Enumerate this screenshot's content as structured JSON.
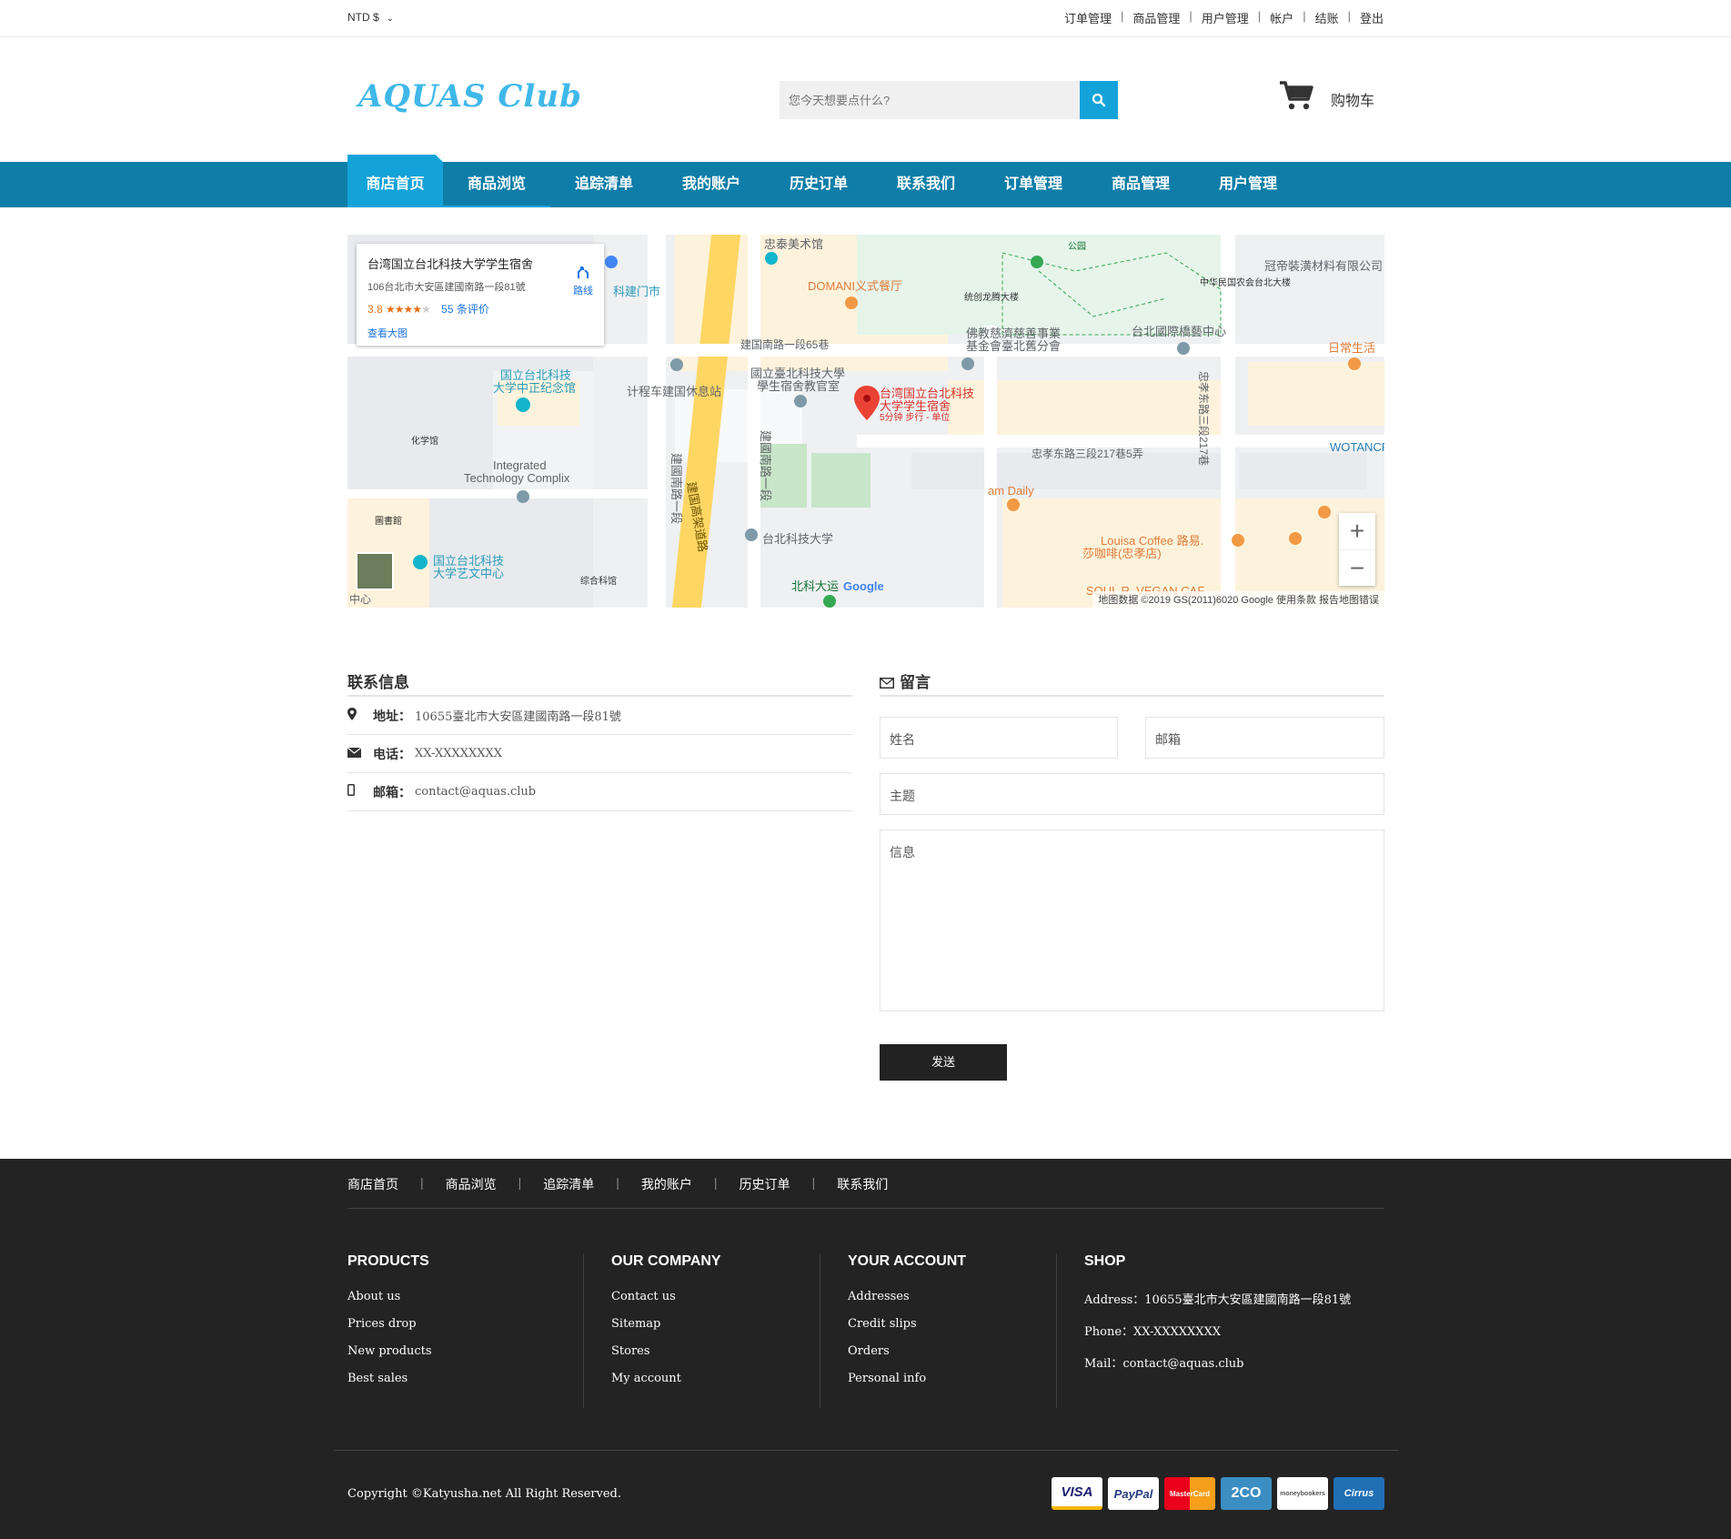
{
  "topbar": {
    "currency": "NTD $",
    "links": [
      "订单管理",
      "商品管理",
      "用户管理",
      "帐户",
      "结账",
      "登出"
    ]
  },
  "header": {
    "logo": "AQUAS Club",
    "search_placeholder": "您今天想要点什么?",
    "cart_label": "购物车"
  },
  "nav": {
    "items": [
      "商店首页",
      "商品浏览",
      "追踪清单",
      "我的账户",
      "历史订单",
      "联系我们",
      "订单管理",
      "商品管理",
      "用户管理"
    ]
  },
  "map": {
    "card": {
      "title": "台湾国立台北科技大学学生宿舍",
      "address": "106台北市大安區建國南路一段81號",
      "rating": "3.8",
      "stars": "★★★★",
      "stars_empty": "★",
      "reviews": "55 条评价",
      "view_large": "查看大图",
      "route": "路线"
    },
    "labels": {
      "l1": "国立台北科技",
      "l1b": "大学中正纪念馆",
      "l2": "计程车建国休息站",
      "l3": "國立臺北科技大學",
      "l3b": "學生宿舍教官室",
      "l4": "台湾国立台北科技",
      "l4b": "大学学生宿舍",
      "l4c": "5分钟 步行 - 单位",
      "l5": "DOMANI义式餐厅",
      "l6": "佛教慈濟慈善事業",
      "l6b": "基金會臺北舊分會",
      "l7": "台北國際橋藝中心",
      "l8": "日常生活",
      "l9": "冠帝裝潢材料有限公司",
      "l10": "中华民国农会台北大楼",
      "l11": "统创龙腾大楼",
      "l12": "建国南路一段65巷",
      "l13": "忠孝东路三段217巷5弄",
      "l14": "WOTANCR",
      "l15": "am Daily",
      "l16": "Louisa Coffee 路易.",
      "l16b": "莎咖啡(忠孝店)",
      "l17": "SOUL R. VEGAN CAF",
      "l18": "台北科技大学",
      "l19": "北科大运",
      "l20": "Integrated",
      "l20b": "Technology Complix",
      "l21": "国立台北科技",
      "l21b": "大学艺文中心",
      "l22": "化学馆",
      "l23": "圖書館",
      "l24": "综合科馆",
      "l25": "建國南路一段",
      "l26": "建国高架道路",
      "l27": "建國南路一段",
      "l28": "忠孝东路三段217巷",
      "l29": "科建门市",
      "l30": "忠泰美术馆",
      "l31": "公园",
      "l32": "中心"
    },
    "footer": "地图数据 ©2019 GS(2011)6020 Google   使用条款   报告地图错误",
    "google": "Google"
  },
  "contact": {
    "title": "联系信息",
    "rows": [
      {
        "key": "地址：",
        "value": "10655臺北市大安區建國南路一段81號",
        "icon": "map-marker-icon"
      },
      {
        "key": "电话：",
        "value": "XX-XXXXXXXX",
        "icon": "envelope-icon"
      },
      {
        "key": "邮箱：",
        "value": "contact@aquas.club",
        "icon": "mobile-icon"
      }
    ]
  },
  "message": {
    "title": "留言",
    "name_placeholder": "姓名",
    "email_placeholder": "邮箱",
    "subject_placeholder": "主题",
    "message_placeholder": "信息",
    "send": "发送"
  },
  "footer": {
    "links": [
      "商店首页",
      "商品浏览",
      "追踪清单",
      "我的账户",
      "历史订单",
      "联系我们"
    ],
    "products": {
      "title": "PRODUCTS",
      "items": [
        "About us",
        "Prices drop",
        "New products",
        "Best sales"
      ]
    },
    "company": {
      "title": "OUR COMPANY",
      "items": [
        "Contact us",
        "Sitemap",
        "Stores",
        "My account"
      ]
    },
    "account": {
      "title": "YOUR ACCOUNT",
      "items": [
        "Addresses",
        "Credit slips",
        "Orders",
        "Personal info"
      ]
    },
    "shop": {
      "title": "SHOP",
      "items": [
        "Address：10655臺北市大安區建國南路一段81號",
        "Phone：XX-XXXXXXXX",
        "Mail：contact@aquas.club"
      ]
    },
    "copyright": "Copyright ©Katyusha.net All Right Reserved.",
    "payments": [
      "VISA",
      "PayPal",
      "MasterCard",
      "2CO",
      "moneybookers",
      "Cirrus"
    ]
  },
  "colors": {
    "accent": "#14a3d9",
    "nav": "#0e7ea8",
    "footer_bg": "#232323"
  }
}
